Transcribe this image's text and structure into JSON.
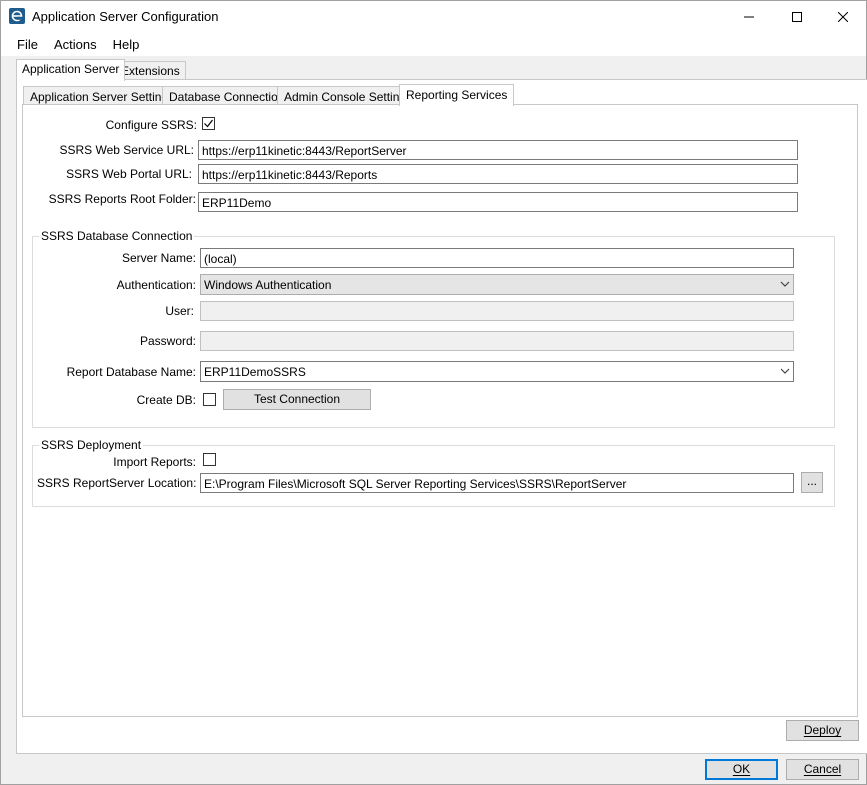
{
  "window": {
    "title": "Application Server Configuration"
  },
  "menu": {
    "items": [
      "File",
      "Actions",
      "Help"
    ]
  },
  "outer_tabs": [
    "Application Server",
    "Extensions"
  ],
  "inner_tabs": [
    "Application Server Settings",
    "Database Connection",
    "Admin Console Settings",
    "Reporting Services"
  ],
  "reporting": {
    "configure_ssrs_label": "Configure SSRS:",
    "configure_ssrs_checked": true,
    "web_service_url_label": "SSRS Web Service URL:",
    "web_service_url_value": "https://erp11kinetic:8443/ReportServer",
    "web_portal_url_label": "SSRS Web Portal URL:",
    "web_portal_url_value": "https://erp11kinetic:8443/Reports",
    "root_folder_label": "SSRS Reports Root Folder:",
    "root_folder_value": "ERP11Demo"
  },
  "db_group": {
    "title": "SSRS Database Connection",
    "server_name_label": "Server Name:",
    "server_name_value": "(local)",
    "authentication_label": "Authentication:",
    "authentication_value": "Windows Authentication",
    "user_label": "User:",
    "user_value": "",
    "password_label": "Password:",
    "password_value": "",
    "report_db_label": "Report Database Name:",
    "report_db_value": "ERP11DemoSSRS",
    "create_db_label": "Create DB:",
    "create_db_checked": false,
    "test_connection_label": "Test Connection"
  },
  "deploy_group": {
    "title": "SSRS Deployment",
    "import_reports_label": "Import Reports:",
    "import_reports_checked": false,
    "location_label": "SSRS ReportServer Location:",
    "location_value": "E:\\Program Files\\Microsoft SQL Server Reporting Services\\SSRS\\ReportServer",
    "browse_label": "..."
  },
  "buttons": {
    "deploy": "Deploy",
    "ok": "OK",
    "cancel": "Cancel"
  }
}
